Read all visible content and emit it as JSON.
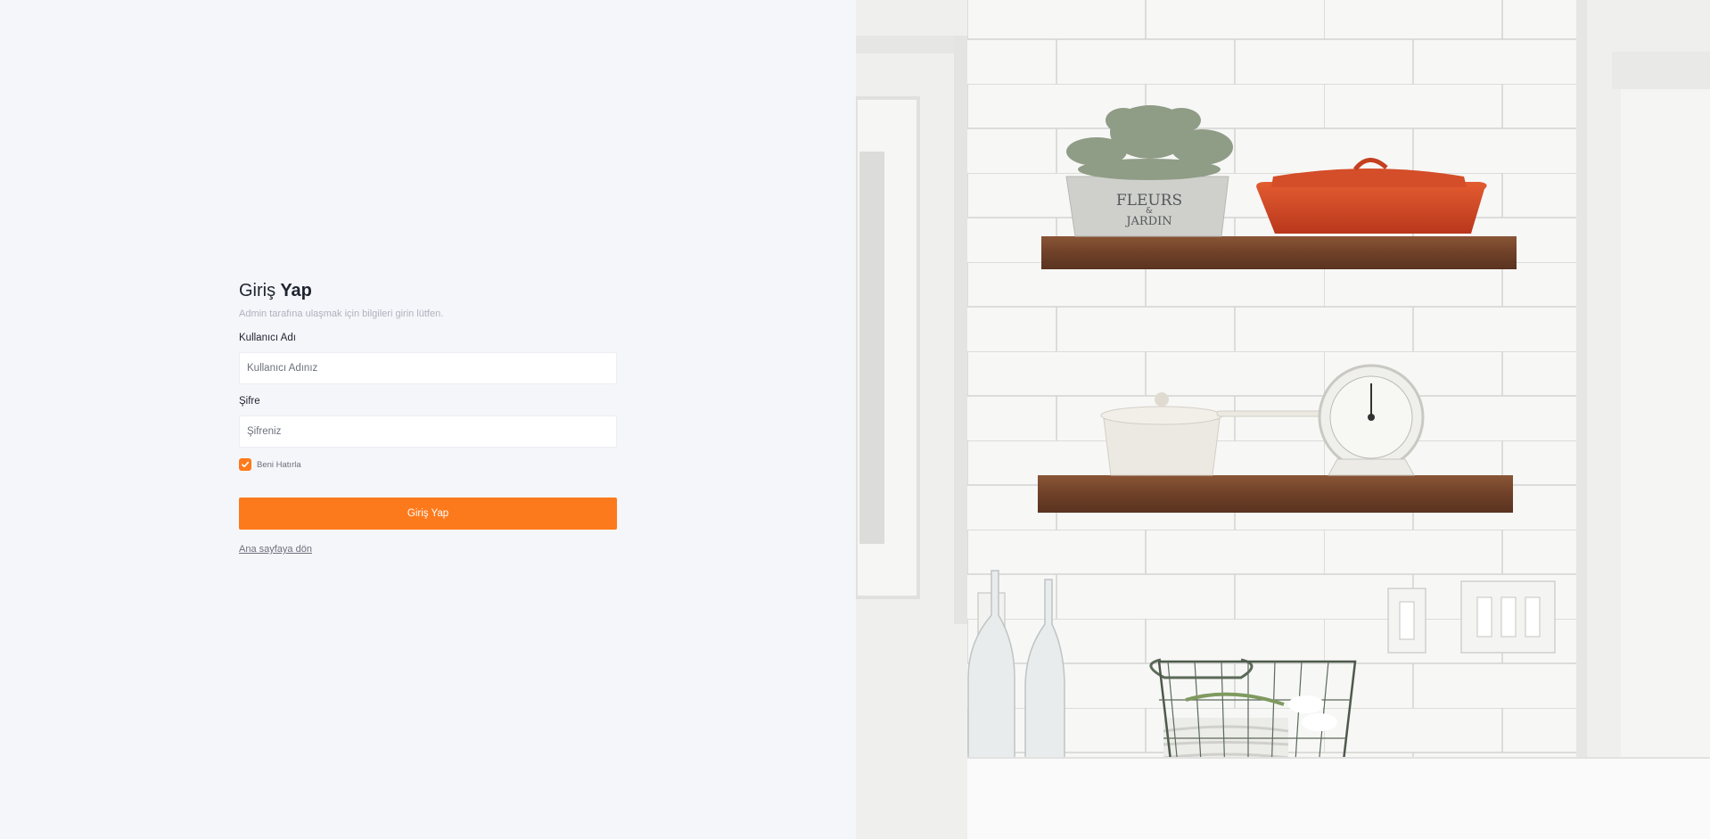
{
  "login": {
    "title_light": "Giriş",
    "title_bold": "Yap",
    "subtitle": "Admin tarafına ulaşmak için bilgileri girin lütfen.",
    "username_label": "Kullanıcı Adı",
    "username_placeholder": "Kullanıcı Adınız",
    "username_value": "",
    "password_label": "Şifre",
    "password_placeholder": "Şifreniz",
    "password_value": "",
    "remember_label": "Beni Hatırla",
    "remember_checked": true,
    "submit_label": "Giriş Yap",
    "back_link_label": "Ana sayfaya dön"
  },
  "photo": {
    "description_icon": "kitchen-shelves-photo",
    "pot_label_line1": "FLEURS",
    "pot_label_line2": "&",
    "pot_label_line3": "JARDIN"
  },
  "colors": {
    "accent": "#fd7a1c",
    "background": "#f5f6fa",
    "text": "#1f2430",
    "muted": "#aeb3bd"
  }
}
